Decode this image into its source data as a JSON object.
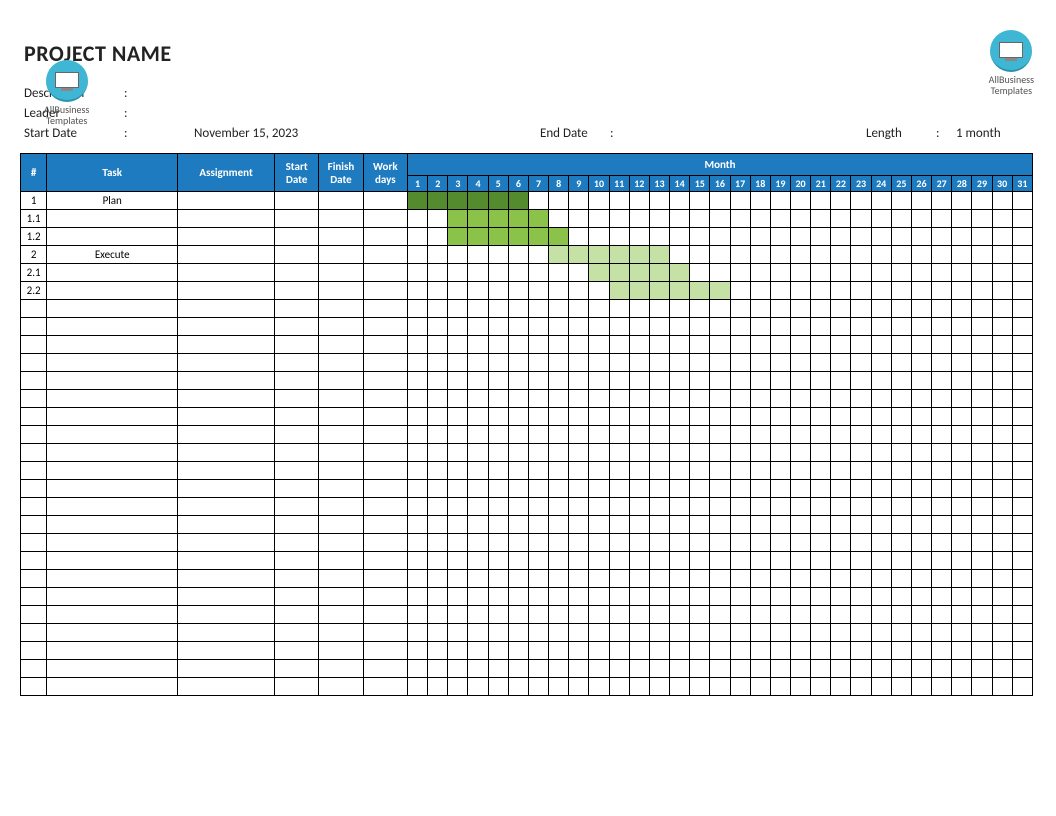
{
  "brand": "AllBusiness\nTemplates",
  "title": "PROJECT NAME",
  "meta": {
    "description_label": "Description",
    "leader_label": "Leader",
    "start_label": "Start Date",
    "start_value": "November 15, 2023",
    "end_label": "End Date",
    "end_value": "",
    "length_label": "Length",
    "length_value": "1 month",
    "colon": ":"
  },
  "headers": {
    "num": "#",
    "task": "Task",
    "assignment": "Assignment",
    "start": "Start Date",
    "finish": "Finish Date",
    "work": "Work days",
    "month": "Month"
  },
  "days": [
    "1",
    "2",
    "3",
    "4",
    "5",
    "6",
    "7",
    "8",
    "9",
    "10",
    "11",
    "12",
    "13",
    "14",
    "15",
    "16",
    "17",
    "18",
    "19",
    "20",
    "21",
    "22",
    "23",
    "24",
    "25",
    "26",
    "27",
    "28",
    "29",
    "30",
    "31"
  ],
  "rows": [
    {
      "num": "1",
      "task": "Plan",
      "bars": [
        {
          "from": 1,
          "to": 6,
          "cls": "dark"
        }
      ]
    },
    {
      "num": "1.1",
      "task": "",
      "bars": [
        {
          "from": 3,
          "to": 7,
          "cls": "mid"
        }
      ]
    },
    {
      "num": "1.2",
      "task": "",
      "bars": [
        {
          "from": 3,
          "to": 8,
          "cls": "mid"
        }
      ]
    },
    {
      "num": "2",
      "task": "Execute",
      "bars": [
        {
          "from": 8,
          "to": 13,
          "cls": "light"
        }
      ]
    },
    {
      "num": "2.1",
      "task": "",
      "bars": [
        {
          "from": 10,
          "to": 14,
          "cls": "light"
        }
      ]
    },
    {
      "num": "2.2",
      "task": "",
      "bars": [
        {
          "from": 11,
          "to": 16,
          "cls": "light"
        }
      ]
    },
    {
      "num": "",
      "task": ""
    },
    {
      "num": "",
      "task": ""
    },
    {
      "num": "",
      "task": ""
    },
    {
      "num": "",
      "task": ""
    },
    {
      "num": "",
      "task": ""
    },
    {
      "num": "",
      "task": ""
    },
    {
      "num": "",
      "task": ""
    },
    {
      "num": "",
      "task": ""
    },
    {
      "num": "",
      "task": ""
    },
    {
      "num": "",
      "task": ""
    },
    {
      "num": "",
      "task": ""
    },
    {
      "num": "",
      "task": ""
    },
    {
      "num": "",
      "task": ""
    },
    {
      "num": "",
      "task": ""
    },
    {
      "num": "",
      "task": ""
    },
    {
      "num": "",
      "task": ""
    },
    {
      "num": "",
      "task": ""
    },
    {
      "num": "",
      "task": ""
    },
    {
      "num": "",
      "task": ""
    },
    {
      "num": "",
      "task": ""
    },
    {
      "num": "",
      "task": ""
    },
    {
      "num": "",
      "task": ""
    }
  ],
  "chart_data": {
    "type": "gantt",
    "title": "PROJECT NAME",
    "xlabel": "Month",
    "x_range": [
      1,
      31
    ],
    "tasks": [
      {
        "id": "1",
        "name": "Plan",
        "start": 1,
        "end": 6,
        "level": 0
      },
      {
        "id": "1.1",
        "name": "",
        "start": 3,
        "end": 7,
        "level": 1
      },
      {
        "id": "1.2",
        "name": "",
        "start": 3,
        "end": 8,
        "level": 1
      },
      {
        "id": "2",
        "name": "Execute",
        "start": 8,
        "end": 13,
        "level": 0
      },
      {
        "id": "2.1",
        "name": "",
        "start": 10,
        "end": 14,
        "level": 1
      },
      {
        "id": "2.2",
        "name": "",
        "start": 11,
        "end": 16,
        "level": 1
      }
    ]
  }
}
